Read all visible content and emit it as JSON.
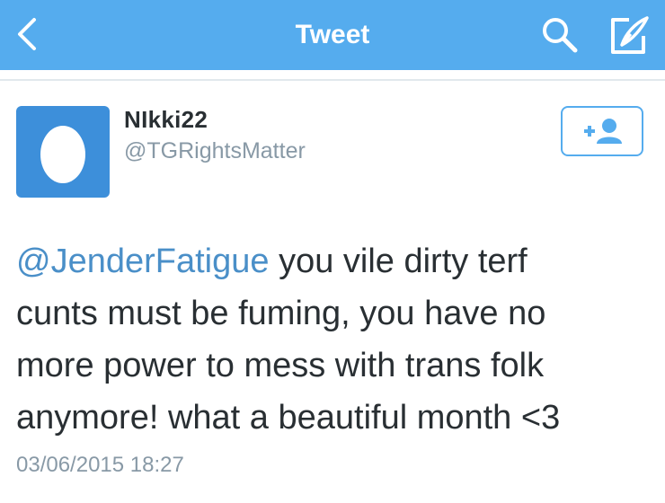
{
  "nav": {
    "title": "Tweet",
    "back_icon": "chevron-left-icon",
    "search_icon": "search-icon",
    "compose_icon": "compose-icon"
  },
  "user": {
    "name": "NIkki22",
    "handle": "@TGRightsMatter",
    "avatar_icon": "default-egg-avatar"
  },
  "follow_button": {
    "icon": "add-user-icon"
  },
  "tweet": {
    "mention": "@JenderFatigue",
    "line1_rest": " you vile dirty terf",
    "line2": "cunts must be fuming, you have no",
    "line3": "more power to mess with trans folk",
    "line4": "anymore!  what a beautiful month <3",
    "timestamp": "03/06/2015 18:27"
  },
  "colors": {
    "nav_bg": "#55acee",
    "avatar_bg": "#3d8fda",
    "mention": "#4a8fc8",
    "meta_text": "#8899a6",
    "body_text": "#292f33"
  }
}
